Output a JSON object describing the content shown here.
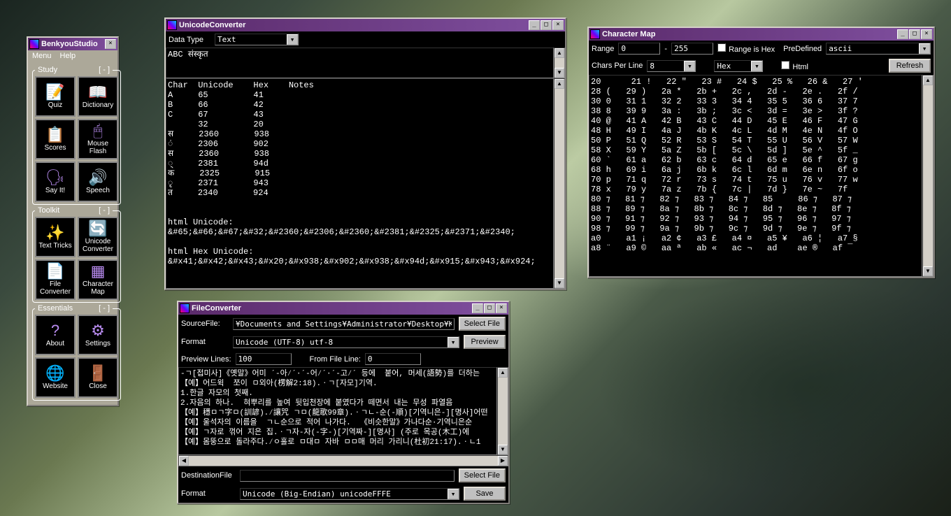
{
  "toolbox": {
    "title": "BenkyouStudio",
    "menu": [
      "Menu",
      "Help"
    ],
    "groups": {
      "study": {
        "title": "Study",
        "collapse": "[ - ]",
        "items": [
          {
            "icon": "📝",
            "label": "Quiz"
          },
          {
            "icon": "📖",
            "label": "Dictionary"
          },
          {
            "icon": "📋",
            "label": "Scores"
          },
          {
            "icon": "🖱",
            "label": "Mouse Flash"
          },
          {
            "icon": "🗣",
            "label": "Say It!"
          },
          {
            "icon": "🔊",
            "label": "Speech"
          }
        ]
      },
      "toolkit": {
        "title": "Toolkit",
        "collapse": "[ - ]",
        "items": [
          {
            "icon": "✨",
            "label": "Text Tricks"
          },
          {
            "icon": "🔄",
            "label": "Unicode Converter"
          },
          {
            "icon": "📄",
            "label": "File Converter"
          },
          {
            "icon": "▦",
            "label": "Character Map"
          }
        ]
      },
      "essentials": {
        "title": "Essentials",
        "collapse": "[ - ]",
        "items": [
          {
            "icon": "?",
            "label": "About"
          },
          {
            "icon": "⚙",
            "label": "Settings"
          },
          {
            "icon": "🌐",
            "label": "Website"
          },
          {
            "icon": "🚪",
            "label": "Close"
          }
        ]
      }
    }
  },
  "uconv": {
    "title": "UnicodeConverter",
    "datatype_label": "Data Type",
    "datatype_value": "Text",
    "input": "ABC संस्कृत",
    "output": "Char  Unicode    Hex    Notes\nA     65         41\nB     66         42\nC     67         43\n      32         20\nस     2360       938\nं     2306       902\nस     2360       938\n्     2381       94d\nक     2325       915\nृ     2371       943\nत     2340       924\n\n\nhtml Unicode:\n&#65;&#66;&#67;&#32;&#2360;&#2306;&#2360;&#2381;&#2325;&#2371;&#2340;\n\nhtml Hex Unicode:\n&#x41;&#x42;&#x43;&#x20;&#x938;&#x902;&#x938;&#x94d;&#x915;&#x943;&#x924;"
  },
  "charmap": {
    "title": "Character Map",
    "labels": {
      "range": "Range",
      "rangeis": "Range is Hex",
      "predef": "PreDefined",
      "cpl": "Chars Per Line",
      "html": "Html",
      "refresh": "Refresh"
    },
    "range_from": "0",
    "range_to": "255",
    "predef_value": "ascii",
    "cpl_value": "8",
    "mode": "Hex",
    "grid": "20      21 !   22 \"   23 #   24 $   25 %   26 &   27 '\n28 (   29 )   2a *   2b +   2c ,   2d -   2e .   2f /\n30 0   31 1   32 2   33 3   34 4   35 5   36 6   37 7\n38 8   39 9   3a :   3b ;   3c <   3d =   3e >   3f ?\n40 @   41 A   42 B   43 C   44 D   45 E   46 F   47 G\n48 H   49 I   4a J   4b K   4c L   4d M   4e N   4f O\n50 P   51 Q   52 R   53 S   54 T   55 U   56 V   57 W\n58 X   59 Y   5a Z   5b [   5c \\   5d ]   5e ^   5f _\n60 `   61 a   62 b   63 c   64 d   65 e   66 f   67 g\n68 h   69 i   6a j   6b k   6c l   6d m   6e n   6f o\n70 p   71 q   72 r   73 s   74 t   75 u   76 v   77 w\n78 x   79 y   7a z   7b {   7c |   7d }   7e ~   7f \n80 ⁊   81 ⁊   82 ⁊   83 ⁊   84 ⁊   85     86 ⁊   87 ⁊\n88 ⁊   89 ⁊   8a ⁊   8b ⁊   8c ⁊   8d ⁊   8e ⁊   8f ⁊\n90 ⁊   91 ⁊   92 ⁊   93 ⁊   94 ⁊   95 ⁊   96 ⁊   97 ⁊\n98 ⁊   99 ⁊   9a ⁊   9b ⁊   9c ⁊   9d ⁊   9e ⁊   9f ⁊\na0     a1 ¡   a2 ¢   a3 £   a4 ¤   a5 ¥   a6 ¦   a7 §\na8 ¨   a9 ©   aa ª   ab «   ac ¬   ad ­   ae ®   af ¯"
  },
  "fconv": {
    "title": "FileConverter",
    "labels": {
      "source": "SourceFile:",
      "format": "Format",
      "prevlines": "Preview Lines:",
      "fromline": "From File Line:",
      "dest": "DestinationFile",
      "selectfile": "Select File",
      "preview": "Preview",
      "save": "Save"
    },
    "source_path": "¥Documents and Settings¥Administrator¥Desktop¥KoreanDic.dict",
    "src_format": "Unicode (UTF-8)                    utf-8",
    "preview_lines": "100",
    "from_line": "0",
    "dest_path": "",
    "dst_format": "Unicode (Big-Endian)          unicodeFFFE",
    "preview_text": "-ㄱ[접미사]《옛말》어미 ´-아⁄´·´-어⁄´·´-고⁄´ 등에  붙어, 머세(語勢)를 더하는\n【예】어드윅  쪼이 ㅁ외아(楞解2:18).ㆍㄱ[자모]기역.\n1.한글 자모의 첫째.\n2.자음의 하나.  혀뿌리를 높여 뒷입천장에 붙였다가 떼면서 내는 무성 파열음\n【예】穩ㅁㄱ字ㅁ(訓諺).⁄讓咒 ㄱㅁ(龍歌99章).ㆍㄱㄴ-순(-順)[기역니은-][명사]어떤\n【예】울석자의 이름을  ㄱㄴ순으로 적어 나가다.  《비슷한말》가나다순·기역니은순\n【예】ㄱ자로 꺾어 지은 집.ㆍㄱ자-자(-字-)[기역짜-][명사] (주로 목공(木工)에\n【예】몸뚱으로 돌라주다.⁄ㅇ홀로 ㅁ대ㅁ 자바 ㅁㅁ매 머리 가리니(杜初21:17).ㆍㄴ1"
  }
}
